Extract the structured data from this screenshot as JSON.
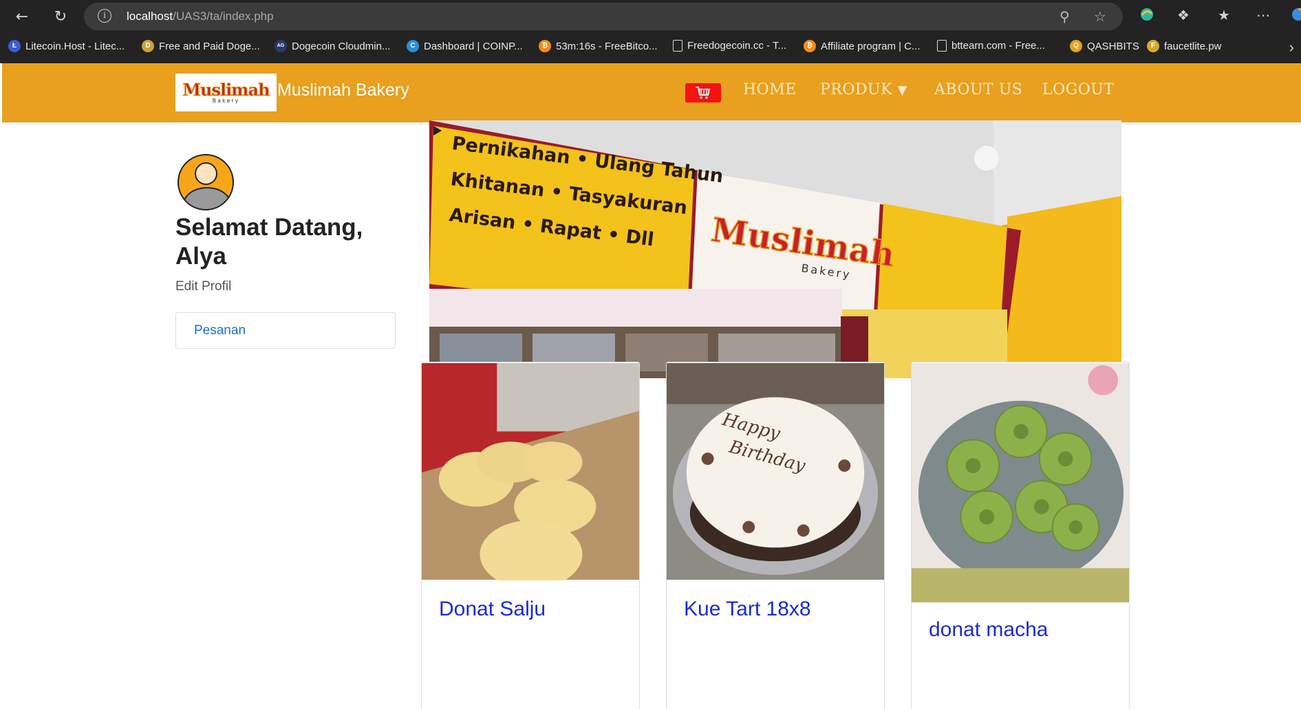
{
  "browser": {
    "url_host": "localhost",
    "url_path": "/UAS3/ta/index.php",
    "bookmarks": [
      {
        "label": "Litecoin.Host - Litec...",
        "icon": "litecoin-icon",
        "color": "#3b5bd1"
      },
      {
        "label": "Free and Paid Doge...",
        "icon": "dogecoin-icon",
        "color": "#c9a43a"
      },
      {
        "label": "Dogecoin Cloudmin...",
        "icon": "cloudmining-icon",
        "color": "#2a3a6a"
      },
      {
        "label": "Dashboard | COINP...",
        "icon": "coinpot-icon",
        "color": "#2a8fd8"
      },
      {
        "label": "53m:16s - FreeBitco...",
        "icon": "bitcoin-icon",
        "color": "#f28c1a"
      },
      {
        "label": "Freedogecoin.cc - T...",
        "icon": "file-icon",
        "color": ""
      },
      {
        "label": "Affiliate program | C...",
        "icon": "bitcoin-icon",
        "color": "#f28c1a"
      },
      {
        "label": "bttearn.com - Free...",
        "icon": "file-icon",
        "color": ""
      },
      {
        "label": "QASHBITS",
        "icon": "qashbits-icon",
        "color": "#e8a01e"
      },
      {
        "label": "faucetlite.pw",
        "icon": "faucet-icon",
        "color": "#d4aa2a"
      }
    ]
  },
  "site": {
    "brand": "Muslimah Bakery",
    "logo_text": "Muslimah",
    "logo_sub": "Bakery",
    "nav": {
      "home": "HOME",
      "produk": "PRODUK",
      "about": "ABOUT US",
      "logout": "LOGOUT"
    },
    "accent": "#e8a01e"
  },
  "sidebar": {
    "welcome": "Selamat Datang, Alya",
    "edit_profil": "Edit Profil",
    "pesanan": "Pesanan"
  },
  "carousel": {
    "sign_left": [
      "Pernikahan • Ulang Tahun",
      "Khitanan • Tasyakuran",
      "Arisan • Rapat • Dll"
    ],
    "sign_brand": "Muslimah",
    "sign_brand_sub": "Bakery",
    "slides": 3,
    "active_slide": 2
  },
  "products": [
    {
      "name": "Donat Salju"
    },
    {
      "name": "Kue Tart 18x8"
    },
    {
      "name": "donat macha"
    }
  ]
}
